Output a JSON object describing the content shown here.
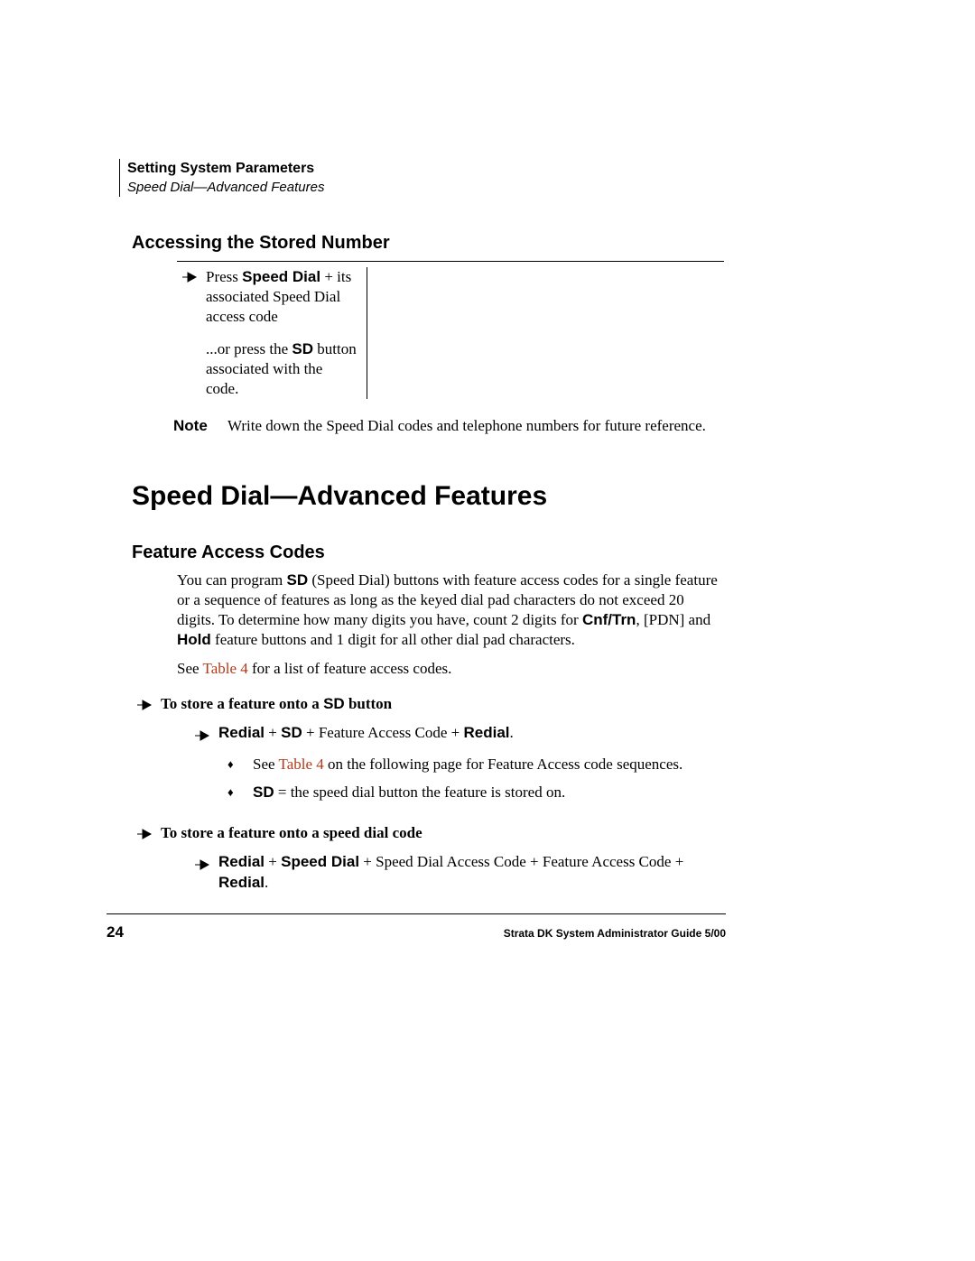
{
  "header": {
    "chapter": "Setting System Parameters",
    "section": "Speed Dial—Advanced Features"
  },
  "sec1": {
    "heading": "Accessing the Stored Number",
    "step1_a": "Press ",
    "step1_b": "Speed Dial",
    "step1_c": " + its associated Speed Dial access code",
    "step2_a": "...or press the ",
    "step2_b": "SD",
    "step2_c": " button associated with the code.",
    "note_label": "Note",
    "note_text": "Write down the Speed Dial codes and telephone numbers for future reference."
  },
  "h1": "Speed Dial—Advanced Features",
  "sec2": {
    "heading": "Feature Access Codes",
    "p1_a": "You can program ",
    "p1_b": "SD",
    "p1_c": " (Speed Dial) buttons with feature access codes for a single feature or a sequence of features as long as the keyed dial pad characters do not exceed 20 digits. To determine how many digits you have, count 2 digits for ",
    "p1_d": "Cnf/Trn",
    "p1_e": ", [PDN] and ",
    "p1_f": "Hold",
    "p1_g": " feature buttons and 1 digit for all other dial pad characters.",
    "p2_a": "See ",
    "p2_b": "Table 4",
    "p2_c": " for a list of feature access codes.",
    "proc1_a": "To store a feature onto a ",
    "proc1_b": "SD",
    "proc1_c": " button",
    "s1_a": "Redial",
    "s1_b": " + ",
    "s1_c": "SD",
    "s1_d": " + Feature Access Code + ",
    "s1_e": "Redial",
    "s1_f": ".",
    "d1_a": "See ",
    "d1_b": "Table 4",
    "d1_c": " on the following page for Feature Access code sequences.",
    "d2_a": "SD",
    "d2_b": " = the speed dial button the feature is stored on.",
    "proc2": "To store a feature onto a speed dial code",
    "s2_a": "Redial",
    "s2_b": " + ",
    "s2_c": "Speed Dial",
    "s2_d": " + Speed Dial Access Code + Feature Access Code + ",
    "s2_e": "Redial",
    "s2_f": "."
  },
  "footer": {
    "page": "24",
    "text": "Strata DK System Administrator Guide   5/00"
  }
}
